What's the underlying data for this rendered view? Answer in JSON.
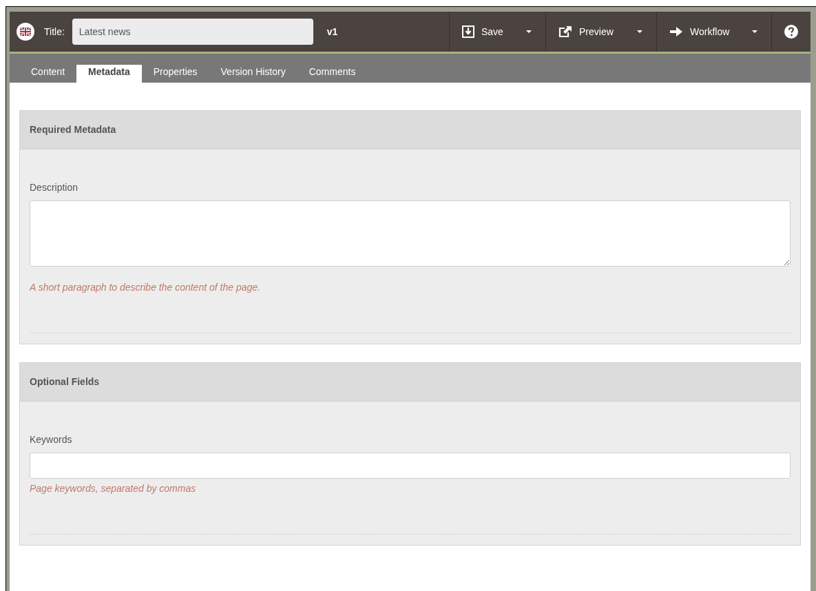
{
  "header": {
    "title_label": "Title:",
    "title_value": "Latest news",
    "version": "v1",
    "actions": [
      {
        "kind": "save",
        "label": "Save",
        "has_menu": true
      },
      {
        "kind": "preview",
        "label": "Preview",
        "has_menu": true
      },
      {
        "kind": "workflow",
        "label": "Workflow",
        "has_menu": true
      }
    ]
  },
  "tabs": [
    {
      "label": "Content",
      "selected": false
    },
    {
      "label": "Metadata",
      "selected": true
    },
    {
      "label": "Properties",
      "selected": false
    },
    {
      "label": "Version History",
      "selected": false
    },
    {
      "label": "Comments",
      "selected": false
    }
  ],
  "sections": [
    {
      "title": "Required Metadata",
      "fields": [
        {
          "kind": "textarea",
          "label": "Description",
          "help": "A short paragraph to describe the content of the page."
        }
      ]
    },
    {
      "title": "Optional Fields",
      "fields": [
        {
          "kind": "text",
          "label": "Keywords",
          "help": "Page keywords, separated by commas"
        }
      ]
    }
  ]
}
